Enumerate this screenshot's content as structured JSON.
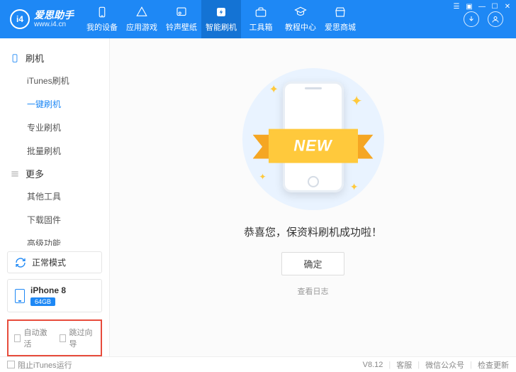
{
  "header": {
    "brand": "爱思助手",
    "url": "www.i4.cn",
    "nav": [
      {
        "label": "我的设备"
      },
      {
        "label": "应用游戏"
      },
      {
        "label": "铃声壁纸"
      },
      {
        "label": "智能刷机"
      },
      {
        "label": "工具箱"
      },
      {
        "label": "教程中心"
      },
      {
        "label": "爱思商城"
      }
    ]
  },
  "sidebar": {
    "section1": {
      "title": "刷机",
      "items": [
        "iTunes刷机",
        "一键刷机",
        "专业刷机",
        "批量刷机"
      ]
    },
    "section2": {
      "title": "更多",
      "items": [
        "其他工具",
        "下载固件",
        "高级功能"
      ]
    },
    "mode_label": "正常模式",
    "device_name": "iPhone 8",
    "storage": "64GB",
    "check_auto": "自动激活",
    "check_skip": "跳过向导"
  },
  "main": {
    "ribbon": "NEW",
    "success": "恭喜您，保资料刷机成功啦！",
    "confirm": "确定",
    "view_log": "查看日志"
  },
  "footer": {
    "block_itunes": "阻止iTunes运行",
    "version": "V8.12",
    "links": [
      "客服",
      "微信公众号",
      "检查更新"
    ]
  }
}
